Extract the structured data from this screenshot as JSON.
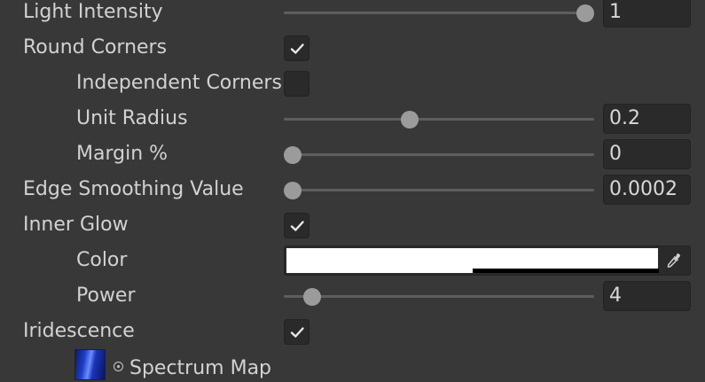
{
  "light_intensity": {
    "label": "Light Intensity",
    "value": "1",
    "slider_fraction": 1.0
  },
  "round_corners": {
    "label": "Round Corners",
    "checked": true
  },
  "independent_corners": {
    "label": "Independent Corners",
    "checked": false
  },
  "unit_radius": {
    "label": "Unit Radius",
    "value": "0.2",
    "slider_fraction": 0.4
  },
  "margin": {
    "label": "Margin %",
    "value": "0",
    "slider_fraction": 0.0
  },
  "edge_smoothing": {
    "label": "Edge Smoothing Value",
    "value": "0.0002",
    "slider_fraction": 0.0
  },
  "inner_glow": {
    "label": "Inner Glow",
    "checked": true
  },
  "color": {
    "label": "Color",
    "value": "#FFFFFF",
    "alpha": 0.5
  },
  "power": {
    "label": "Power",
    "value": "4",
    "slider_fraction": 0.066
  },
  "iridescence": {
    "label": "Iridescence",
    "checked": true
  },
  "spectrum_map": {
    "label": "Spectrum Map"
  },
  "colors": {
    "background": "#383838",
    "text": "#d2d2d2",
    "field_bg": "#2a2a2a",
    "slider_thumb": "#9b9b9b",
    "slider_track": "#5e5e5e"
  }
}
